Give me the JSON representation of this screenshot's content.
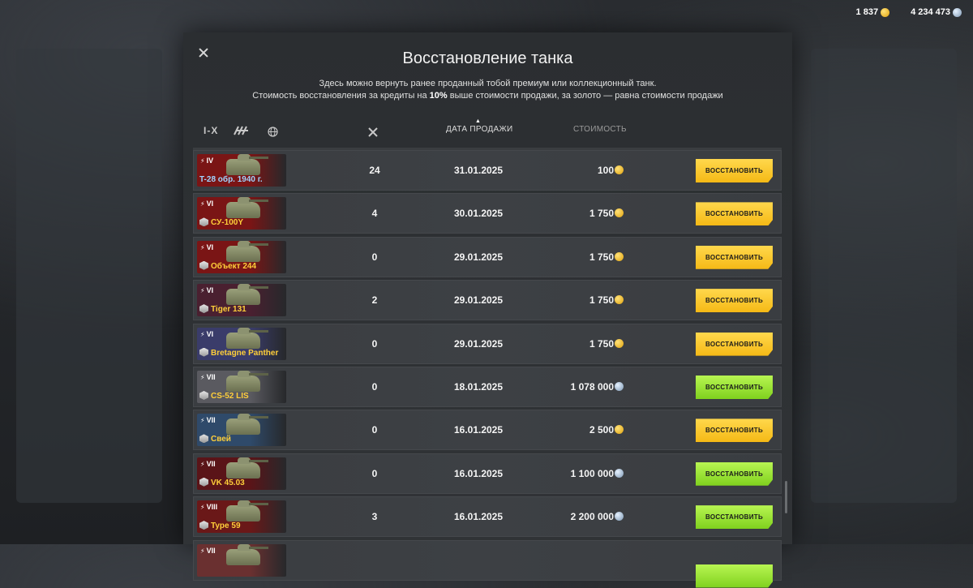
{
  "currency": {
    "gold": "1 837",
    "credits": "4 234 473"
  },
  "modal": {
    "title": "Восстановление танка",
    "subtitle_line1": "Здесь можно вернуть ранее проданный тобой премиум или коллекционный танк.",
    "subtitle_line2_pre": "Стоимость восстановления за кредиты на ",
    "subtitle_line2_bold": "10%",
    "subtitle_line2_post": " выше стоимости продажи, за золото — равна стоимости продажи"
  },
  "header": {
    "filter_tier": "I-X",
    "date_label": "ДАТА ПРОДАЖИ",
    "cost_label": "СТОИМОСТЬ"
  },
  "restore_label": "ВОССТАНОВИТЬ",
  "rows": [
    {
      "tier": "IV",
      "name": "T-28 обр. 1940 г.",
      "name_color": "blue",
      "badge": false,
      "flag": "ussr",
      "battles": "24",
      "date": "31.01.2025",
      "cost": "100",
      "currency": "gold"
    },
    {
      "tier": "VI",
      "name": "СУ-100Y",
      "name_color": "gold",
      "badge": true,
      "flag": "ussr",
      "battles": "4",
      "date": "30.01.2025",
      "cost": "1 750",
      "currency": "gold"
    },
    {
      "tier": "VI",
      "name": "Объект 244",
      "name_color": "gold",
      "badge": true,
      "flag": "ussr",
      "battles": "0",
      "date": "29.01.2025",
      "cost": "1 750",
      "currency": "gold"
    },
    {
      "tier": "VI",
      "name": "Tiger 131",
      "name_color": "gold",
      "badge": true,
      "flag": "uk",
      "battles": "2",
      "date": "29.01.2025",
      "cost": "1 750",
      "currency": "gold"
    },
    {
      "tier": "VI",
      "name": "Bretagne Panther",
      "name_color": "gold",
      "badge": true,
      "flag": "france",
      "battles": "0",
      "date": "29.01.2025",
      "cost": "1 750",
      "currency": "gold"
    },
    {
      "tier": "VII",
      "name": "CS-52 LIS",
      "name_color": "gold",
      "badge": true,
      "flag": "poland",
      "battles": "0",
      "date": "18.01.2025",
      "cost": "1 078 000",
      "currency": "credits"
    },
    {
      "tier": "VII",
      "name": "Свей",
      "name_color": "gold",
      "badge": true,
      "flag": "sweden",
      "battles": "0",
      "date": "16.01.2025",
      "cost": "2 500",
      "currency": "gold"
    },
    {
      "tier": "VII",
      "name": "VK 45.03",
      "name_color": "gold",
      "badge": true,
      "flag": "germany",
      "battles": "0",
      "date": "16.01.2025",
      "cost": "1 100 000",
      "currency": "credits"
    },
    {
      "tier": "VIII",
      "name": "Type 59",
      "name_color": "gold",
      "badge": true,
      "flag": "china",
      "battles": "3",
      "date": "16.01.2025",
      "cost": "2 200 000",
      "currency": "credits"
    },
    {
      "tier": "VII",
      "name": "",
      "name_color": "gold",
      "badge": false,
      "flag": "usa",
      "battles": "",
      "date": "",
      "cost": "",
      "currency": "credits"
    }
  ],
  "flag_colors": {
    "ussr": "#7a1515",
    "uk": "#4a2030",
    "france": "#3a3c6a",
    "poland": "#5a5a60",
    "sweden": "#2f4a6a",
    "germany": "#5a1418",
    "china": "#6a1818",
    "usa": "#6a3030"
  }
}
